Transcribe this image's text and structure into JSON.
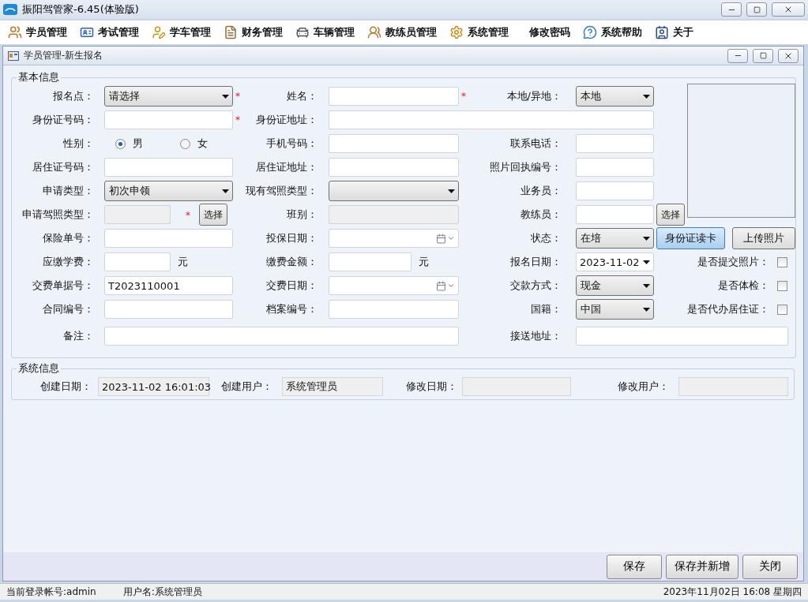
{
  "app_title": "振阳驾管家-6.45(体验版)",
  "menu": [
    {
      "label": "学员管理",
      "kind": "students"
    },
    {
      "label": "考试管理",
      "kind": "exam"
    },
    {
      "label": "学车管理",
      "kind": "learning"
    },
    {
      "label": "财务管理",
      "kind": "finance"
    },
    {
      "label": "车辆管理",
      "kind": "vehicle"
    },
    {
      "label": "教练员管理",
      "kind": "coach"
    },
    {
      "label": "系统管理",
      "kind": "system"
    },
    {
      "label": "修改密码",
      "kind": "plain"
    },
    {
      "label": "系统帮助",
      "kind": "help"
    },
    {
      "label": "关于",
      "kind": "about"
    }
  ],
  "child_window": {
    "title": "学员管理-新生报名"
  },
  "basic_info": {
    "legend": "基本信息",
    "rows": [
      {
        "cells": [
          {
            "label": "报名点：",
            "kind": "select",
            "value": "请选择",
            "required_mark": "*"
          },
          {
            "label": "姓名：",
            "kind": "text",
            "required_mark": "*",
            "disabled": false
          },
          {
            "label": "本地/异地：",
            "kind": "select",
            "value": "本地"
          }
        ]
      },
      {
        "cells": [
          {
            "label": "身份证号码：",
            "kind": "text",
            "required_mark": "*",
            "disabled": false
          },
          {
            "label": "身份证地址：",
            "kind": "text",
            "disabled": false
          }
        ]
      },
      {
        "cells": [
          {
            "label": "性别：",
            "kind": "radio",
            "options": [
              {
                "label": "男",
                "selected": true
              },
              {
                "label": "女",
                "selected": false
              }
            ]
          },
          {
            "label": "手机号码：",
            "kind": "text",
            "disabled": false
          },
          {
            "label": "联系电话：",
            "kind": "text",
            "disabled": false
          }
        ]
      },
      {
        "cells": [
          {
            "label": "居住证号码：",
            "kind": "text",
            "disabled": false
          },
          {
            "label": "居住证地址：",
            "kind": "text",
            "disabled": false
          },
          {
            "label": "照片回执编号：",
            "kind": "text",
            "disabled": false
          }
        ]
      },
      {
        "cells": [
          {
            "label": "申请类型：",
            "kind": "select",
            "value": "初次申领"
          },
          {
            "label": "现有驾照类型：",
            "kind": "select"
          },
          {
            "label": "业务员：",
            "kind": "text",
            "disabled": false
          }
        ]
      },
      {
        "cells": [
          {
            "label": "申请驾照类型：",
            "kind": "text",
            "required_mark": "*",
            "disabled": true,
            "button": "选择"
          },
          {
            "label": "班别：",
            "kind": "text",
            "disabled": true
          },
          {
            "label": "教练员：",
            "kind": "text",
            "disabled": false,
            "button": "选择"
          }
        ]
      },
      {
        "cells": [
          {
            "label": "保险单号：",
            "kind": "text",
            "disabled": false
          },
          {
            "label": "投保日期：",
            "kind": "date"
          },
          {
            "label": "状态：",
            "kind": "select",
            "value": "在培"
          },
          {
            "kind": "buttons",
            "buttons": [
              {
                "label": "身份证读卡",
                "focused": true
              },
              {
                "label": "上传照片",
                "focused": false
              }
            ]
          }
        ]
      },
      {
        "cells": [
          {
            "label": "应缴学费：",
            "kind": "text",
            "disabled": false,
            "unit": "元"
          },
          {
            "label": "缴费金额：",
            "kind": "text",
            "disabled": false,
            "unit": "元"
          },
          {
            "label": "报名日期：",
            "kind": "datepicker",
            "value": "2023-11-02"
          },
          {
            "label": "是否提交照片：",
            "kind": "checkbox",
            "checked": false
          }
        ]
      },
      {
        "cells": [
          {
            "label": "交费单据号：",
            "kind": "text",
            "value": "T2023110001",
            "disabled": false
          },
          {
            "label": "交费日期：",
            "kind": "date"
          },
          {
            "label": "交款方式：",
            "kind": "select",
            "value": "现金"
          },
          {
            "label": "是否体检：",
            "kind": "checkbox",
            "checked": false
          }
        ]
      },
      {
        "cells": [
          {
            "label": "合同编号：",
            "kind": "text",
            "disabled": false
          },
          {
            "label": "档案编号：",
            "kind": "text",
            "disabled": false
          },
          {
            "label": "国籍：",
            "kind": "select",
            "value": "中国"
          },
          {
            "label": "是否代办居住证：",
            "kind": "checkbox",
            "checked": false
          }
        ]
      },
      {
        "cells": [
          {
            "label": "备注：",
            "kind": "text",
            "disabled": false
          },
          "",
          {
            "label": "接送地址：",
            "kind": "text",
            "disabled": false
          }
        ]
      }
    ]
  },
  "system_info": {
    "legend": "系统信息",
    "fields": [
      {
        "label": "创建日期：",
        "value": "2023-11-02 16:01:03"
      },
      {
        "label": "创建用户：",
        "value": "系统管理员"
      },
      {
        "label": "修改日期："
      },
      {
        "label": "修改用户："
      }
    ]
  },
  "actions": [
    "保存",
    "保存并新增",
    "关闭"
  ],
  "status_bar": {
    "account": "当前登录帐号:admin",
    "user": "用户名:系统管理员",
    "datetime": "2023年11月02日 16:08 星期四"
  }
}
